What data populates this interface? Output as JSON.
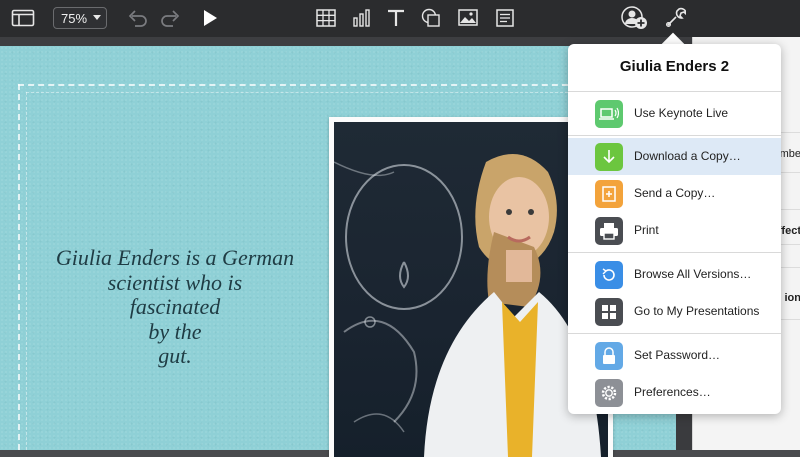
{
  "toolbar": {
    "zoom_value": "75%",
    "icons": [
      "sidebar-icon",
      "undo-icon",
      "redo-icon",
      "play-icon",
      "table-icon",
      "chart-icon",
      "text-icon",
      "shape-icon",
      "media-icon",
      "comment-icon",
      "collaborate-icon",
      "tools-icon"
    ]
  },
  "slide": {
    "text_lines": [
      "Giulia Enders is a German",
      "scientist who is",
      "fascinated",
      "by the",
      "gut."
    ]
  },
  "inspector": {
    "labels": [
      "mbe",
      "ffect",
      "ion"
    ]
  },
  "popover": {
    "title": "Giulia Enders 2",
    "items": [
      {
        "label": "Use Keynote Live",
        "icon": "keynote-live-icon",
        "color": "#5ec96f"
      },
      {
        "label": "Download a Copy…",
        "icon": "download-icon",
        "color": "#6cc63f"
      },
      {
        "label": "Send a Copy…",
        "icon": "send-copy-icon",
        "color": "#f3a33b"
      },
      {
        "label": "Print",
        "icon": "print-icon",
        "color": "#4a4d52"
      },
      {
        "label": "Browse All Versions…",
        "icon": "versions-icon",
        "color": "#3a8ee6"
      },
      {
        "label": "Go to My Presentations",
        "icon": "presentations-icon",
        "color": "#4a4d52"
      },
      {
        "label": "Set Password…",
        "icon": "lock-icon",
        "color": "#63a9e6"
      },
      {
        "label": "Preferences…",
        "icon": "gear-icon",
        "color": "#8d9096"
      }
    ]
  }
}
